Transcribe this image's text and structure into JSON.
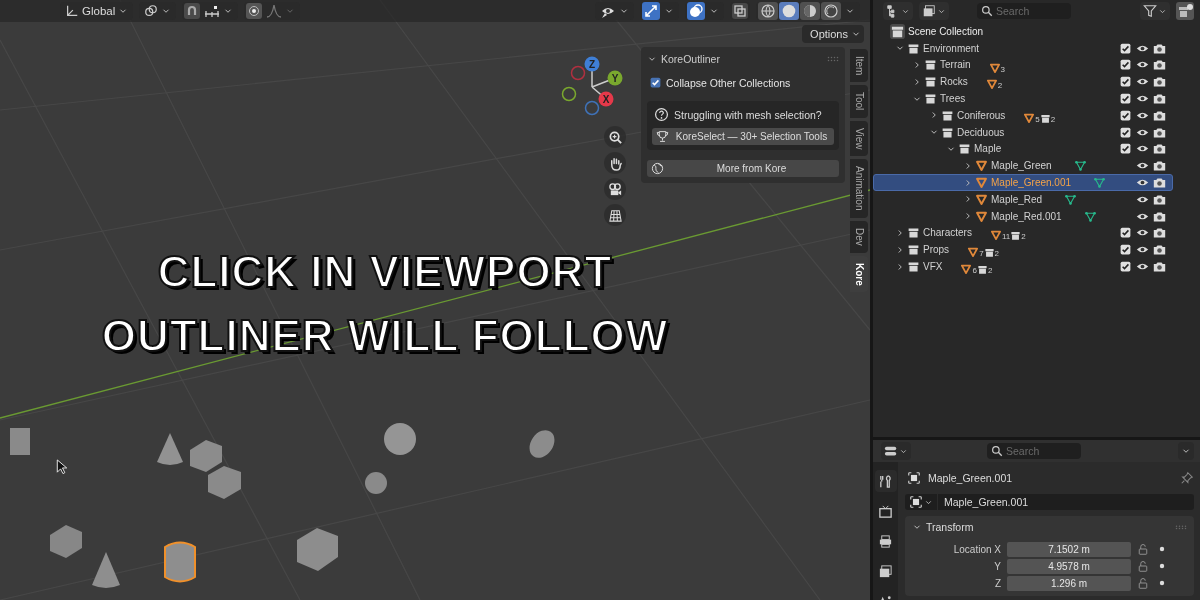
{
  "viewport": {
    "header": {
      "orientation": "Global",
      "options": "Options"
    },
    "toggles": [
      {
        "kind": "gizmo",
        "on": true
      },
      {
        "kind": "overlay",
        "on": true
      }
    ],
    "shading_modes": [
      {
        "kind": "wireframe",
        "selected": false
      },
      {
        "kind": "solid",
        "selected": true
      },
      {
        "kind": "material",
        "selected": false
      },
      {
        "kind": "rendered",
        "selected": false
      }
    ],
    "gizmo_labels": [
      "X",
      "Y",
      "Z"
    ],
    "caption": [
      "CLICK IN VIEWPORT",
      "OUTLINER WILL FOLLOW"
    ],
    "kore_panel": {
      "title": "KoreOutliner",
      "expanded": true,
      "checkbox": {
        "label": "Collapse Other Collections",
        "checked": true
      },
      "help_text": "Struggling with mesh selection?",
      "select_button": "KoreSelect — 30+ Selection Tools",
      "more_button": "More from Kore"
    },
    "sidebar_tabs": [
      {
        "label": "Item",
        "selected": false
      },
      {
        "label": "Tool",
        "selected": false
      },
      {
        "label": "View",
        "selected": false
      },
      {
        "label": "Animation",
        "selected": false
      },
      {
        "label": "Dev",
        "selected": false
      },
      {
        "label": "Kore",
        "selected": true
      }
    ]
  },
  "outliner": {
    "search_placeholder": "Search",
    "tree": [
      {
        "kind": "scene",
        "name": "Scene Collection",
        "children": [
          {
            "kind": "collection",
            "name": "Environment",
            "expanded": true,
            "checked": true,
            "children": [
              {
                "kind": "collection",
                "name": "Terrain",
                "expanded": false,
                "checked": true,
                "mesh_count": "3"
              },
              {
                "kind": "collection",
                "name": "Rocks",
                "expanded": false,
                "checked": true,
                "mesh_count": "2"
              },
              {
                "kind": "collection",
                "name": "Trees",
                "expanded": true,
                "checked": true,
                "children": [
                  {
                    "kind": "collection",
                    "name": "Coniferous",
                    "expanded": false,
                    "checked": true,
                    "mesh_count": "5",
                    "collection_count": "2"
                  },
                  {
                    "kind": "collection",
                    "name": "Deciduous",
                    "expanded": true,
                    "checked": true,
                    "children": [
                      {
                        "kind": "collection",
                        "name": "Maple",
                        "expanded": true,
                        "checked": true,
                        "children": [
                          {
                            "kind": "object",
                            "name": "Maple_Green",
                            "expanded": false,
                            "selected": false
                          },
                          {
                            "kind": "object",
                            "name": "Maple_Green.001",
                            "expanded": false,
                            "selected": true
                          },
                          {
                            "kind": "object",
                            "name": "Maple_Red",
                            "expanded": false,
                            "selected": false
                          },
                          {
                            "kind": "object",
                            "name": "Maple_Red.001",
                            "expanded": false,
                            "selected": false
                          }
                        ]
                      }
                    ]
                  }
                ]
              }
            ]
          },
          {
            "kind": "collection",
            "name": "Characters",
            "expanded": false,
            "checked": true,
            "mesh_count": "11",
            "collection_count": "2"
          },
          {
            "kind": "collection",
            "name": "Props",
            "expanded": false,
            "checked": true,
            "mesh_count": "7",
            "collection_count": "2"
          },
          {
            "kind": "collection",
            "name": "VFX",
            "expanded": false,
            "checked": true,
            "mesh_count": "6",
            "collection_count": "2"
          }
        ]
      }
    ]
  },
  "properties": {
    "search_placeholder": "Search",
    "object_name": "Maple_Green.001",
    "data_name": "Maple_Green.001",
    "panel": {
      "title": "Transform",
      "expanded": true
    },
    "fields": [
      {
        "label": "Location X",
        "value": "7.1502 m"
      },
      {
        "label": "Y",
        "value": "4.9578 m"
      },
      {
        "label": "Z",
        "value": "1.296 m"
      }
    ]
  }
}
